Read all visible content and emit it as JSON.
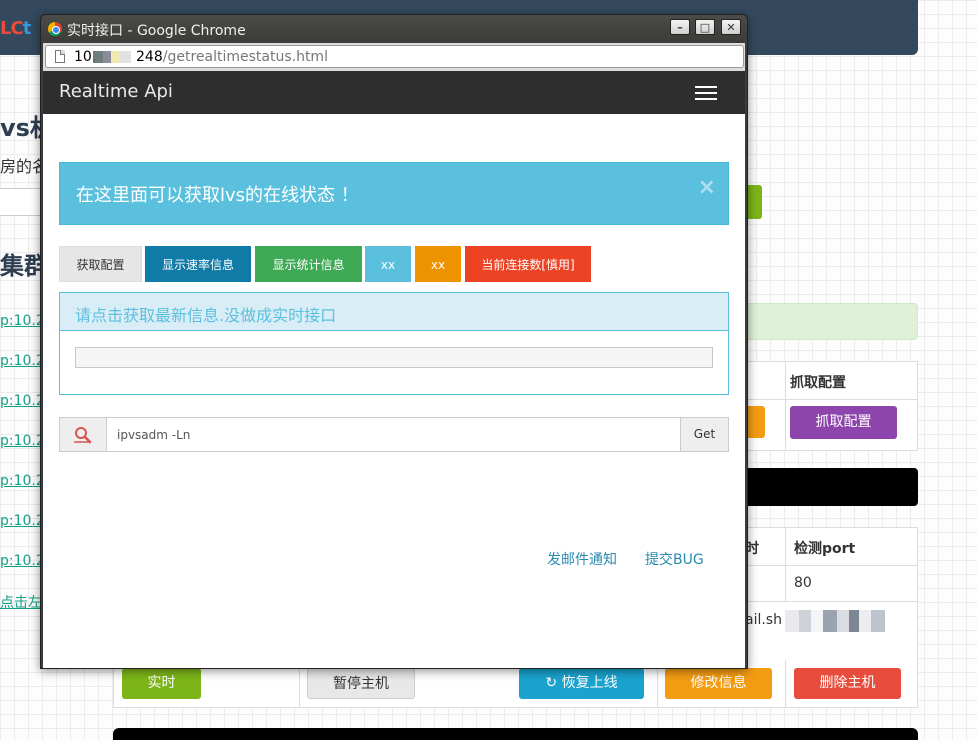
{
  "background": {
    "logo_a": "LC",
    "logo_b": "t",
    "title": "vs机",
    "subtitle": "房的名",
    "input_value": "",
    "section_title": "集群",
    "host_links": [
      "p:10.2",
      "p:10.2",
      "p:10.2",
      "p:10.2",
      "p:10.2",
      "p:10.2",
      "p:10.2"
    ],
    "hint_link": "点击左边",
    "table1_header": "抓取配置",
    "table1_button": "抓取配置",
    "table2_header_a": "时",
    "table2_header_b": "检测port",
    "table2_port": "80",
    "table2_script": "ail.sh",
    "bottom_buttons": {
      "realtime": "实时",
      "pause": "暂停主机",
      "restore": "恢复上线",
      "modify": "修改信息",
      "delete": "删除主机"
    }
  },
  "window": {
    "title": "实时接口 - Google Chrome",
    "minimize": "–",
    "maximize": "□",
    "close": "✕",
    "url_host": "10.",
    "url_tail": "248",
    "url_path": "/getrealtimestatus.html"
  },
  "page": {
    "brand": "Realtime Api",
    "alert_text": "在这里面可以获取lvs的在线状态 ！",
    "alert_close": "×",
    "buttons": {
      "get_config": "获取配置",
      "rate_info": "显示速率信息",
      "stats_info": "显示统计信息",
      "xx1": "xx",
      "xx2": "xx",
      "connections": "当前连接数[慎用]"
    },
    "panel_title": "请点击获取最新信息.没做成实时接口",
    "command_value": "ipvsadm -Ln",
    "get_button": "Get",
    "footer": {
      "email": "发邮件通知",
      "bug": "提交BUG"
    }
  },
  "colors": {
    "navbar_bg": "#34495e",
    "info": "#5bc0de",
    "primary": "#0f7ba6",
    "success": "#3faa55",
    "warning": "#ee9300",
    "danger": "#ec4324",
    "purple": "#8e44ad"
  }
}
